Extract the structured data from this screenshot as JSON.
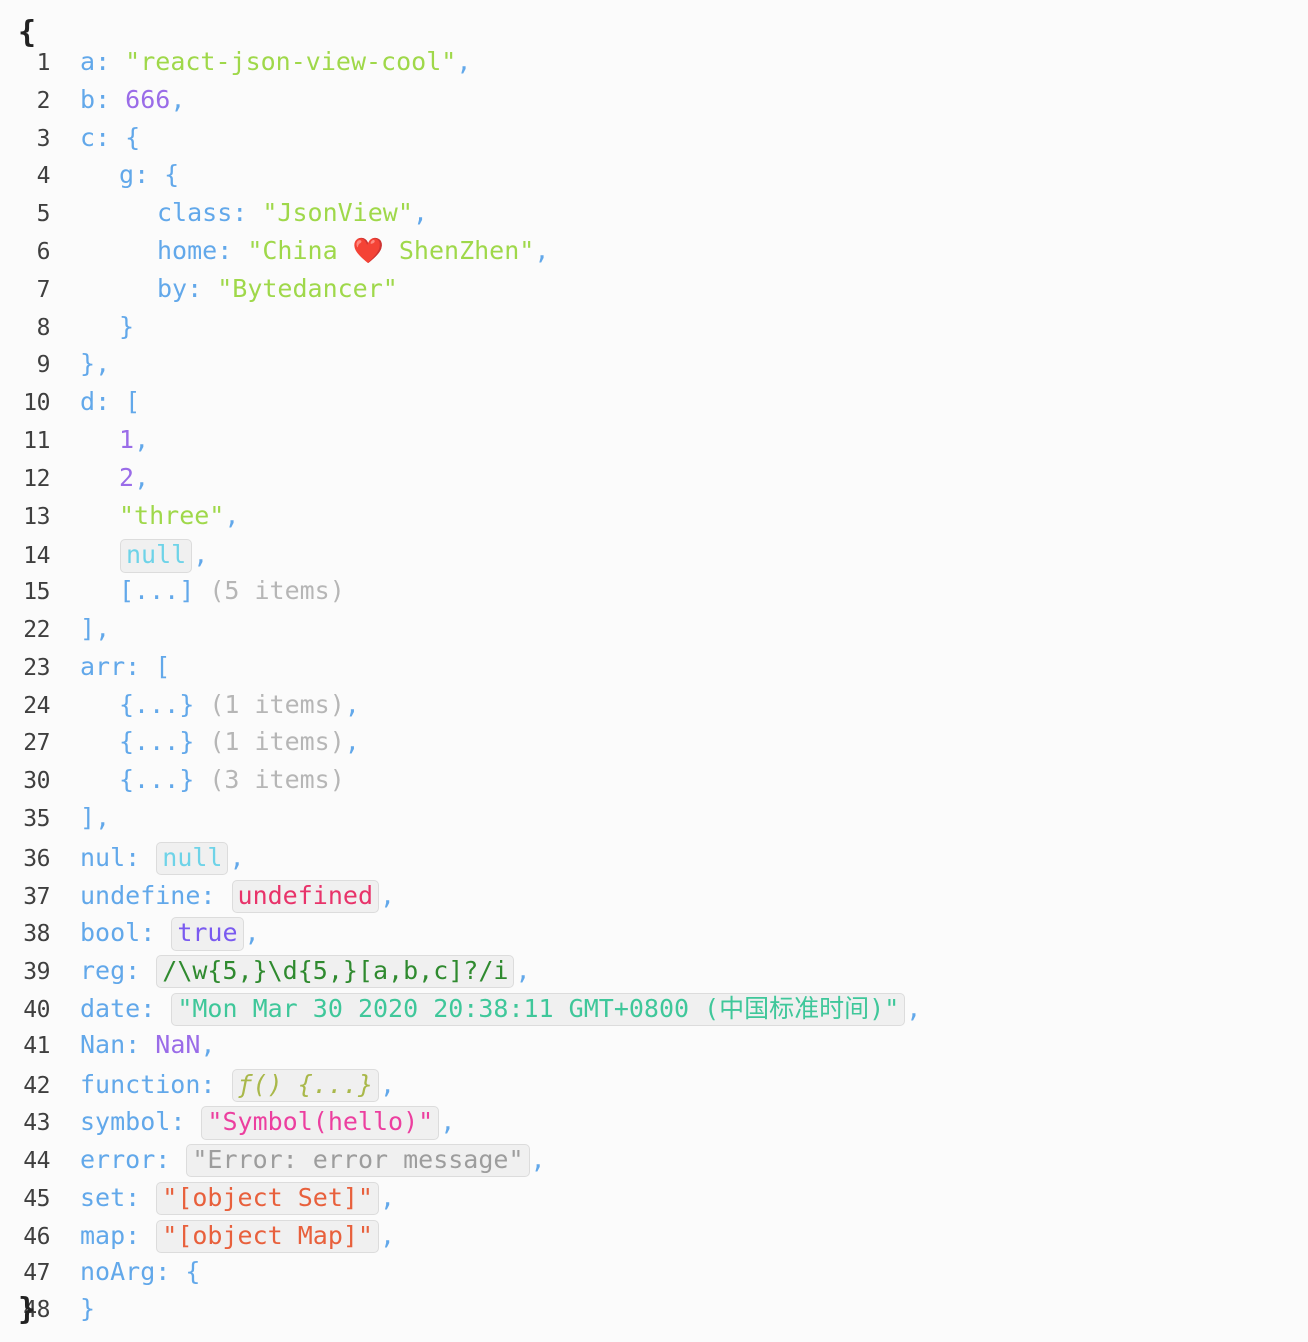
{
  "viewer": {
    "name": "react-json-view-cool",
    "open_brace": "{",
    "close_brace": "}",
    "background": "#fbfbfb",
    "colors": {
      "key": "#62a8ea",
      "punctuation": "#62a8ea",
      "string": "#9fd84a",
      "number": "#9a6ce8",
      "null": "#6ed3e8",
      "undefined": "#e8336a",
      "boolean": "#7a5af0",
      "regexp": "#2f8a2f",
      "date": "#3fc79a",
      "function": "#a9b84a",
      "symbol": "#ec3f9f",
      "error": "#9d9d9d",
      "object_string": "#e8603c",
      "meta": "#b6b6b6",
      "line_number": "#3f3f3f",
      "outer_brace": "#222222"
    }
  },
  "lines": [
    {
      "no": "1",
      "indent": 1,
      "key": "a",
      "punc_after_key": ": ",
      "value": "\"react-json-view-cool\"",
      "type": "str",
      "boxed": false,
      "comma": ","
    },
    {
      "no": "2",
      "indent": 1,
      "key": "b",
      "punc_after_key": ": ",
      "value": "666",
      "type": "num",
      "boxed": false,
      "comma": ","
    },
    {
      "no": "3",
      "indent": 1,
      "key": "c",
      "punc_after_key": ": ",
      "value": "{",
      "type": "punc",
      "boxed": false,
      "comma": ""
    },
    {
      "no": "4",
      "indent": 2,
      "key": "g",
      "punc_after_key": ": ",
      "value": "{",
      "type": "punc",
      "boxed": false,
      "comma": ""
    },
    {
      "no": "5",
      "indent": 3,
      "key": "class",
      "punc_after_key": ": ",
      "value": "\"JsonView\"",
      "type": "str",
      "boxed": false,
      "comma": ","
    },
    {
      "no": "6",
      "indent": 3,
      "key": "home",
      "punc_after_key": ": ",
      "value": "\"China ❤️ ShenZhen\"",
      "type": "str",
      "boxed": false,
      "comma": ","
    },
    {
      "no": "7",
      "indent": 3,
      "key": "by",
      "punc_after_key": ": ",
      "value": "\"Bytedancer\"",
      "type": "str",
      "boxed": false,
      "comma": ""
    },
    {
      "no": "8",
      "indent": 2,
      "key": "",
      "punc_after_key": "",
      "value": "}",
      "type": "punc",
      "boxed": false,
      "comma": ""
    },
    {
      "no": "9",
      "indent": 1,
      "key": "",
      "punc_after_key": "",
      "value": "}",
      "type": "punc",
      "boxed": false,
      "comma": ","
    },
    {
      "no": "10",
      "indent": 1,
      "key": "d",
      "punc_after_key": ": ",
      "value": "[",
      "type": "punc",
      "boxed": false,
      "comma": ""
    },
    {
      "no": "11",
      "indent": 2,
      "key": "",
      "punc_after_key": "",
      "value": "1",
      "type": "num",
      "boxed": false,
      "comma": ","
    },
    {
      "no": "12",
      "indent": 2,
      "key": "",
      "punc_after_key": "",
      "value": "2",
      "type": "num",
      "boxed": false,
      "comma": ","
    },
    {
      "no": "13",
      "indent": 2,
      "key": "",
      "punc_after_key": "",
      "value": "\"three\"",
      "type": "str",
      "boxed": false,
      "comma": ","
    },
    {
      "no": "14",
      "indent": 2,
      "key": "",
      "punc_after_key": "",
      "value": "null",
      "type": "nul",
      "boxed": true,
      "comma": ","
    },
    {
      "no": "15",
      "indent": 2,
      "key": "",
      "punc_after_key": "",
      "value": "[...]",
      "type": "punc",
      "boxed": false,
      "comma": "",
      "meta": " (5 items)"
    },
    {
      "no": "22",
      "indent": 1,
      "key": "",
      "punc_after_key": "",
      "value": "]",
      "type": "punc",
      "boxed": false,
      "comma": ","
    },
    {
      "no": "23",
      "indent": 1,
      "key": "arr",
      "punc_after_key": ": ",
      "value": "[",
      "type": "punc",
      "boxed": false,
      "comma": ""
    },
    {
      "no": "24",
      "indent": 2,
      "key": "",
      "punc_after_key": "",
      "value": "{...}",
      "type": "punc",
      "boxed": false,
      "comma": ",",
      "meta": " (1 items)"
    },
    {
      "no": "27",
      "indent": 2,
      "key": "",
      "punc_after_key": "",
      "value": "{...}",
      "type": "punc",
      "boxed": false,
      "comma": ",",
      "meta": " (1 items)"
    },
    {
      "no": "30",
      "indent": 2,
      "key": "",
      "punc_after_key": "",
      "value": "{...}",
      "type": "punc",
      "boxed": false,
      "comma": "",
      "meta": " (3 items)"
    },
    {
      "no": "35",
      "indent": 1,
      "key": "",
      "punc_after_key": "",
      "value": "]",
      "type": "punc",
      "boxed": false,
      "comma": ","
    },
    {
      "no": "36",
      "indent": 1,
      "key": "nul",
      "punc_after_key": ": ",
      "value": "null",
      "type": "nul",
      "boxed": true,
      "comma": ","
    },
    {
      "no": "37",
      "indent": 1,
      "key": "undefine",
      "punc_after_key": ": ",
      "value": "undefined",
      "type": "undef",
      "boxed": true,
      "comma": ","
    },
    {
      "no": "38",
      "indent": 1,
      "key": "bool",
      "punc_after_key": ": ",
      "value": "true",
      "type": "bool",
      "boxed": true,
      "comma": ","
    },
    {
      "no": "39",
      "indent": 1,
      "key": "reg",
      "punc_after_key": ": ",
      "value": "/\\w{5,}\\d{5,}[a,b,c]?/i",
      "type": "regex",
      "boxed": true,
      "comma": ","
    },
    {
      "no": "40",
      "indent": 1,
      "key": "date",
      "punc_after_key": ": ",
      "value": "\"Mon Mar 30 2020 20:38:11 GMT+0800 (中国标准时间)\"",
      "type": "date",
      "boxed": true,
      "comma": ","
    },
    {
      "no": "41",
      "indent": 1,
      "key": "Nan",
      "punc_after_key": ": ",
      "value": "NaN",
      "type": "num",
      "boxed": false,
      "comma": ","
    },
    {
      "no": "42",
      "indent": 1,
      "key": "function",
      "punc_after_key": ": ",
      "value": "ƒ() {...}",
      "type": "func",
      "boxed": true,
      "comma": ","
    },
    {
      "no": "43",
      "indent": 1,
      "key": "symbol",
      "punc_after_key": ": ",
      "value": "\"Symbol(hello)\"",
      "type": "sym",
      "boxed": true,
      "comma": ","
    },
    {
      "no": "44",
      "indent": 1,
      "key": "error",
      "punc_after_key": ": ",
      "value": "\"Error: error message\"",
      "type": "err",
      "boxed": true,
      "comma": ","
    },
    {
      "no": "45",
      "indent": 1,
      "key": "set",
      "punc_after_key": ": ",
      "value": "\"[object Set]\"",
      "type": "objstr",
      "boxed": true,
      "comma": ","
    },
    {
      "no": "46",
      "indent": 1,
      "key": "map",
      "punc_after_key": ": ",
      "value": "\"[object Map]\"",
      "type": "objstr",
      "boxed": true,
      "comma": ","
    },
    {
      "no": "47",
      "indent": 1,
      "key": "noArg",
      "punc_after_key": ": ",
      "value": "{",
      "type": "punc",
      "boxed": false,
      "comma": ""
    },
    {
      "no": "48",
      "indent": 1,
      "key": "",
      "punc_after_key": "",
      "value": "}",
      "type": "punc",
      "boxed": false,
      "comma": ""
    }
  ]
}
